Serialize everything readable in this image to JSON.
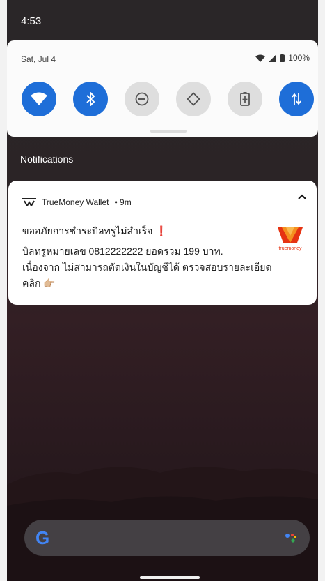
{
  "status_bar": {
    "time": "4:53"
  },
  "quick_settings": {
    "date": "Sat, Jul 4",
    "battery": "100%",
    "tiles": [
      {
        "name": "wifi",
        "state": "on",
        "icon": "wifi-icon"
      },
      {
        "name": "bluetooth",
        "state": "on",
        "icon": "bluetooth-icon"
      },
      {
        "name": "do-not-disturb",
        "state": "off",
        "icon": "do-not-disturb-icon"
      },
      {
        "name": "auto-rotate",
        "state": "off",
        "icon": "auto-rotate-icon"
      },
      {
        "name": "battery-saver",
        "state": "off",
        "icon": "battery-saver-icon"
      },
      {
        "name": "mobile-data",
        "state": "on",
        "icon": "mobile-data-icon"
      }
    ],
    "accent_color": "#1e6ed8"
  },
  "notifications_header": "Notifications",
  "notification": {
    "app_name": "TrueMoney Wallet",
    "time": "• 9m",
    "title": "ขออภัยการชำระบิลทรูไม่สำเร็จ ❗",
    "body_lines": [
      "บิลทรูหมายเลข 0812222222 ยอดรวม 199 บาท.",
      "เนื่องจาก ไม่สามารถตัดเงินในบัญชีได้ ตรวจสอบรายละเอียด",
      "คลิก 👉🏼"
    ],
    "brand_text": "truemoney",
    "brand_color": "#e63312"
  },
  "search_bar": {
    "logo": "G"
  }
}
